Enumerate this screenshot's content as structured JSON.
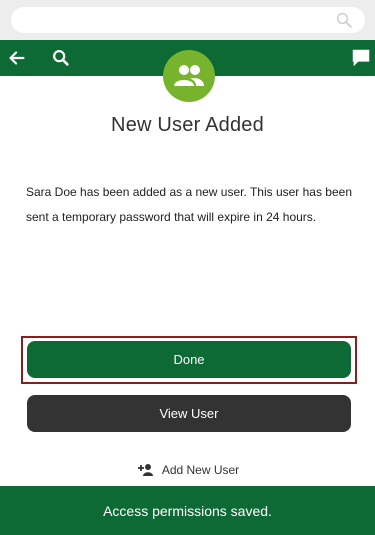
{
  "search": {
    "placeholder": ""
  },
  "header": {
    "back_icon": "arrow-left-icon",
    "search_icon": "search-icon",
    "chat_icon": "chat-bubble-icon"
  },
  "dialog": {
    "icon": "users-icon",
    "title": "New User Added",
    "message": "Sara Doe has been added as a new user. This user has been sent a temporary password that will expire in 24 hours.",
    "done_label": "Done",
    "view_user_label": "View User",
    "add_new_user_label": "Add New User"
  },
  "toast": {
    "text": "Access permissions saved."
  },
  "colors": {
    "brand_green": "#0d6a34",
    "avatar_green": "#77b32c",
    "dark_button": "#333333",
    "highlight_border": "#8b1d1d"
  }
}
